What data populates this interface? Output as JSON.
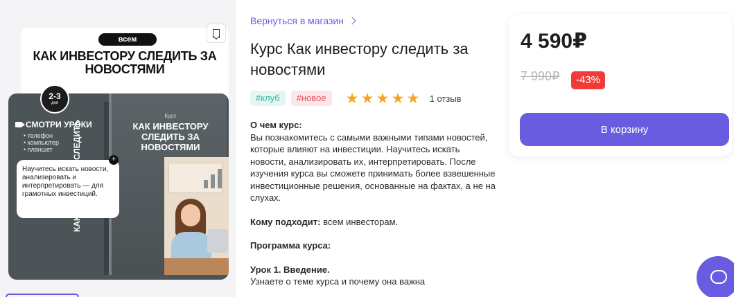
{
  "product_image": {
    "audience_pill": "всем",
    "cover_title": "Как инвестору следить за новостями",
    "duration_number": "2-3",
    "duration_unit": "дня",
    "watch_label": "Смотри уроки",
    "devices": [
      "телефон",
      "компьютер",
      "планшет"
    ],
    "note_text": "Научитесь искать новости, анализировать и интерпретировать — для грамотных инвестиций.",
    "box_label": "Курс",
    "box_title": "Как инвестору следить за новостями",
    "box_spine": "Как инвестору следить"
  },
  "nav": {
    "back_label": "Вернуться в магазин"
  },
  "course": {
    "title": "Курс Как инвестору следить за новостями",
    "tags": [
      "#клуб",
      "#новое"
    ],
    "rating": 5,
    "reviews": "1 отзыв",
    "about_heading": "О чем курс:",
    "about_text": "Вы познакомитесь с самыми важными типами новостей, которые влияют на инвестиции. Научитесь искать новости, анализировать их, интерпретировать. После изучения курса вы сможете принимать более взвешенные инвестиционные решения, основанные на фактах, а не на слухах.",
    "audience_heading": "Кому подходит:",
    "audience_text": "всем инвесторам.",
    "program_heading": "Программа курса:",
    "lesson1_title": "Урок 1. Введение.",
    "lesson1_text": "Узнаете о теме курса и почему она важна"
  },
  "pricing": {
    "price": "4 590₽",
    "old_price": "7 990₽",
    "discount": "-43%",
    "cart_label": "В корзину"
  },
  "colors": {
    "accent": "#6a5ce0",
    "discount": "#f13b3b",
    "star": "#f5a623"
  }
}
